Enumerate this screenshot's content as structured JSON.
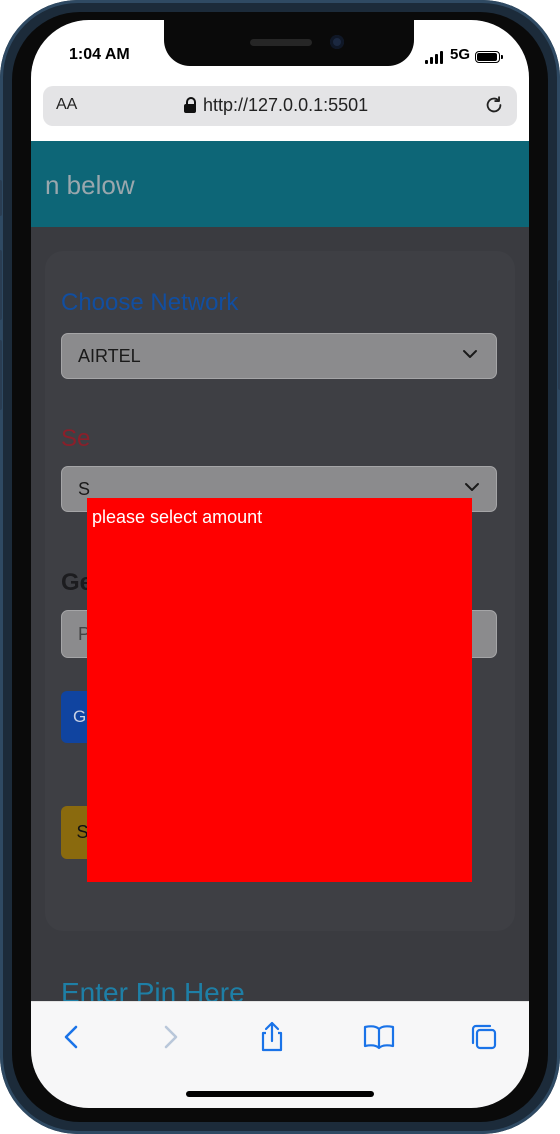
{
  "status_bar": {
    "time": "1:04 AM",
    "network": "5G"
  },
  "browser": {
    "text_size_label": "AA",
    "url": "http://127.0.0.1:5501"
  },
  "page": {
    "header_title": "n below",
    "choose_network_label": "Choose Network",
    "network_select_value": "AIRTEL",
    "amount_label_fragment": "Se",
    "amount_select_fragment": "S",
    "generate_label_fragment": "Ge",
    "pin_input_fragment": "P",
    "generate_button_fragment": "G",
    "save_pin_button": "Save pin",
    "enter_pin_heading": "Enter Pin Here"
  },
  "toast": {
    "message": "please select amount",
    "background": "#ff0000"
  },
  "colors": {
    "header": "#0d6677",
    "network_label": "#114ea0",
    "save_button": "#8a6a0e",
    "enter_pin": "#1e7fa6"
  }
}
